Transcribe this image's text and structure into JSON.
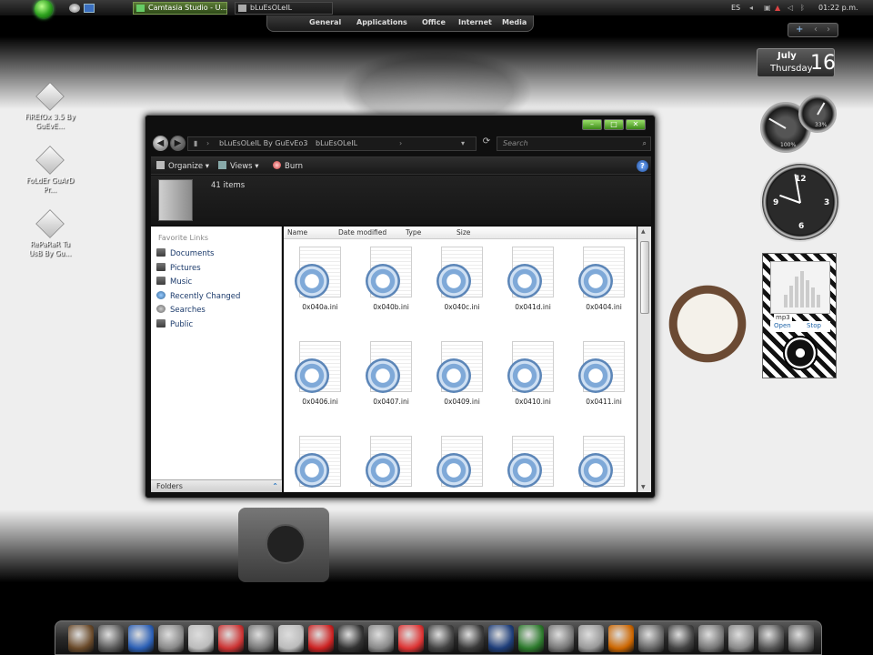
{
  "taskbar": {
    "tasks": [
      {
        "label": "Camtasia Studio - U..."
      },
      {
        "label": "bLuEsOLeIL"
      }
    ],
    "tray": {
      "language": "ES",
      "time": "01:22 p.m."
    },
    "menu": [
      "General",
      "Applications",
      "Office",
      "Internet",
      "Media"
    ]
  },
  "sidebar_buttons": {
    "add": "+",
    "prev": "‹",
    "next": "›"
  },
  "date_gadget": {
    "month": "July",
    "weekday": "Thursday",
    "day": "16"
  },
  "gauges": {
    "cpu_label": "100%",
    "mem_label": "33%"
  },
  "clock": {
    "numerals": [
      "12",
      "3",
      "6",
      "9"
    ]
  },
  "media_gadget": {
    "format": "mp3",
    "open": "Open",
    "stop": "Stop"
  },
  "desktop_icons": [
    {
      "label": "FiREfOx 3.5 By GuEvE..."
    },
    {
      "label": "FoLdEr GuArD Pr..."
    },
    {
      "label": "RePaRaR Tu UsB By Gu..."
    }
  ],
  "explorer": {
    "nav_back": "◀",
    "nav_forward": "▶",
    "breadcrumb": [
      "bLuEsOLeIL By GuEvEo3",
      "bLuEsOLeIL"
    ],
    "breadcrumb_sep": "›",
    "search_placeholder": "Search",
    "toolbar": {
      "organize": "Organize ▾",
      "views": "Views ▾",
      "burn": "Burn"
    },
    "item_count": "41 items",
    "nav_pane": {
      "header": "Favorite Links",
      "items": [
        "Documents",
        "Pictures",
        "Music",
        "Recently Changed",
        "Searches",
        "Public"
      ],
      "folders_label": "Folders",
      "folders_chevron": "⌃"
    },
    "columns": [
      "Name",
      "Date modified",
      "Type",
      "Size"
    ],
    "files": [
      "0x040a.ini",
      "0x040b.ini",
      "0x040c.ini",
      "0x041d.ini",
      "0x0404.ini",
      "0x0406.ini",
      "0x0407.ini",
      "0x0409.ini",
      "0x0410.ini",
      "0x0411.ini",
      "",
      "",
      "",
      "",
      ""
    ]
  },
  "colors": {
    "accent_green": "#3d8a1a",
    "link_blue": "#1b3a6b"
  },
  "dock_icons": [
    "monitor-icon",
    "gimp-icon",
    "word-icon",
    "outlook-icon",
    "notepad-icon",
    "firefox-icon",
    "sphere-icon",
    "itunes-icon",
    "media-player-icon",
    "camera-icon",
    "reel-icon",
    "dvd-icon",
    "clapper-icon",
    "ipod-icon",
    "photoshop-icon",
    "razer-icon",
    "gears-icon",
    "gear-icon",
    "paint-icon",
    "photo-icon",
    "terminal-icon",
    "folder-icon",
    "link-icon",
    "web-icon",
    "trash-icon"
  ]
}
